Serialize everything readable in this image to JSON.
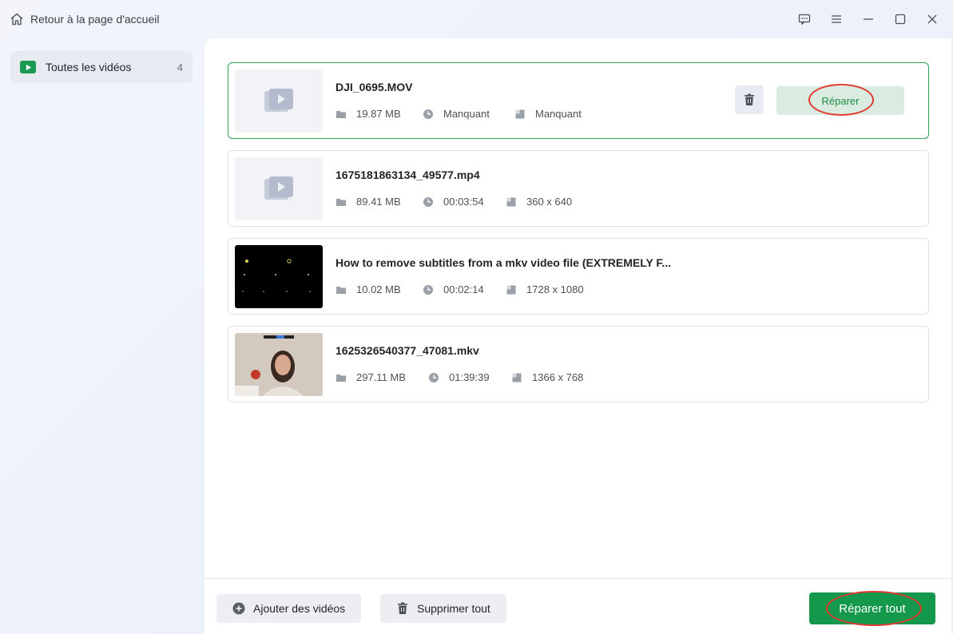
{
  "titlebar": {
    "home_label": "Retour à la page d'accueil",
    "icons": [
      "feedback-icon",
      "menu-icon",
      "minimize-icon",
      "maximize-icon",
      "close-icon"
    ]
  },
  "sidebar": {
    "items": [
      {
        "label": "Toutes les vidéos",
        "count": "4"
      }
    ]
  },
  "videos": [
    {
      "name": "DJI_0695.MOV",
      "size": "19.87 MB",
      "duration": "Manquant",
      "resolution": "Manquant",
      "thumbnail": "placeholder"
    },
    {
      "name": "1675181863134_49577.mp4",
      "size": "89.41 MB",
      "duration": "00:03:54",
      "resolution": "360 x 640",
      "thumbnail": "placeholder"
    },
    {
      "name": "How to remove subtitles from a mkv video file (EXTREMELY F...",
      "size": "10.02 MB",
      "duration": "00:02:14",
      "resolution": "1728 x 1080",
      "thumbnail": "dark"
    },
    {
      "name": "1625326540377_47081.mkv",
      "size": "297.11 MB",
      "duration": "01:39:39",
      "resolution": "1366 x 768",
      "thumbnail": "photo"
    }
  ],
  "selected_card": {
    "repair_label": "Réparer"
  },
  "footer": {
    "add_label": "Ajouter des vidéos",
    "delete_all_label": "Supprimer tout",
    "repair_all_label": "Réparer tout"
  },
  "colors": {
    "accent": "#13984c",
    "highlight": "#e03a34",
    "selected_border": "#2aa05a"
  }
}
